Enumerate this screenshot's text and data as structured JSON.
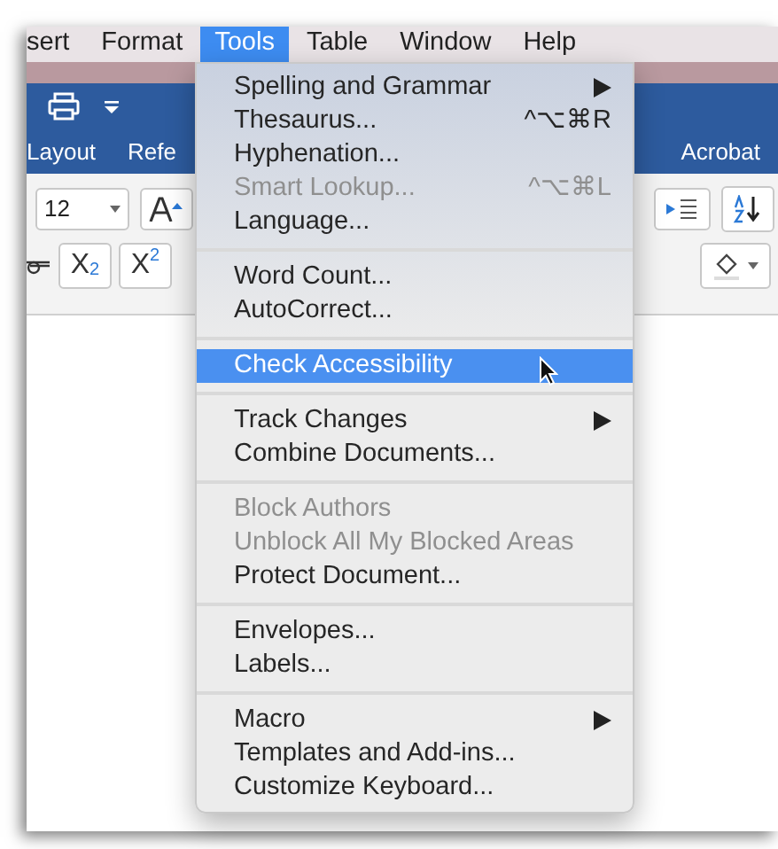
{
  "menu_bar": [
    {
      "label": "sert",
      "selected": false
    },
    {
      "label": "Format",
      "selected": false
    },
    {
      "label": "Tools",
      "selected": true
    },
    {
      "label": "Table",
      "selected": false
    },
    {
      "label": "Window",
      "selected": false
    },
    {
      "label": "Help",
      "selected": false
    }
  ],
  "ribbon_tabs": [
    {
      "label": "Layout"
    },
    {
      "label": "Refe"
    },
    {
      "label": "Acrobat"
    }
  ],
  "font_size": {
    "value": "12"
  },
  "format_buttons": [
    {
      "label": "X$_{2}$"
    },
    {
      "label": "X$^{2}$"
    }
  ],
  "menu": [
    {
      "kind": "item",
      "label": "Spelling and Grammar",
      "submenu": true,
      "disabled": false,
      "selected": false
    },
    {
      "kind": "item",
      "label": "Thesaurus...",
      "shortcut": "^⌥⌘R",
      "submenu": false,
      "disabled": false,
      "selected": false
    },
    {
      "kind": "item",
      "label": "Hyphenation...",
      "submenu": false,
      "disabled": false,
      "selected": false
    },
    {
      "kind": "item",
      "label": "Smart Lookup...",
      "shortcut": "^⌥⌘L",
      "submenu": false,
      "disabled": true,
      "selected": false
    },
    {
      "kind": "item",
      "label": "Language...",
      "submenu": false,
      "disabled": false,
      "selected": false
    },
    {
      "kind": "separator"
    },
    {
      "kind": "item",
      "label": "Word Count...",
      "submenu": false,
      "disabled": false,
      "selected": false
    },
    {
      "kind": "item",
      "label": "AutoCorrect...",
      "submenu": false,
      "disabled": false,
      "selected": false
    },
    {
      "kind": "separator"
    },
    {
      "kind": "item",
      "label": "Check Accessibility",
      "submenu": false,
      "disabled": false,
      "selected": true
    },
    {
      "kind": "separator"
    },
    {
      "kind": "item",
      "label": "Track Changes",
      "submenu": true,
      "disabled": false,
      "selected": false
    },
    {
      "kind": "item",
      "label": "Combine Documents...",
      "submenu": false,
      "disabled": false,
      "selected": false
    },
    {
      "kind": "separator"
    },
    {
      "kind": "item",
      "label": "Block Authors",
      "submenu": false,
      "disabled": true,
      "selected": false
    },
    {
      "kind": "item",
      "label": "Unblock All My Blocked Areas",
      "submenu": false,
      "disabled": true,
      "selected": false
    },
    {
      "kind": "item",
      "label": "Protect Document...",
      "submenu": false,
      "disabled": false,
      "selected": false
    },
    {
      "kind": "separator"
    },
    {
      "kind": "item",
      "label": "Envelopes...",
      "submenu": false,
      "disabled": false,
      "selected": false
    },
    {
      "kind": "item",
      "label": "Labels...",
      "submenu": false,
      "disabled": false,
      "selected": false
    },
    {
      "kind": "separator"
    },
    {
      "kind": "item",
      "label": "Macro",
      "submenu": true,
      "disabled": false,
      "selected": false
    },
    {
      "kind": "item",
      "label": "Templates and Add-ins...",
      "submenu": false,
      "disabled": false,
      "selected": false
    },
    {
      "kind": "item",
      "label": "Customize Keyboard...",
      "submenu": false,
      "disabled": false,
      "selected": false
    }
  ]
}
